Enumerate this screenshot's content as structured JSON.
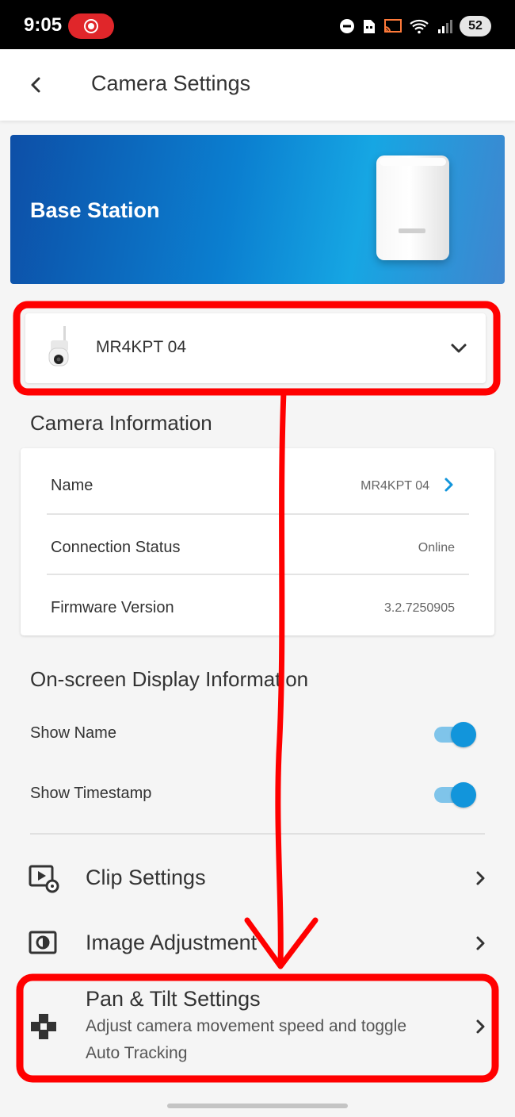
{
  "status_bar": {
    "time": "9:05",
    "battery": "52",
    "icons": [
      "dnd-icon",
      "sim-icon",
      "cast-icon",
      "wifi-icon",
      "signal-icon"
    ]
  },
  "app_bar": {
    "title": "Camera Settings",
    "back_icon": "chevron-left-icon"
  },
  "banner": {
    "title": "Base Station"
  },
  "device_selector": {
    "name": "MR4KPT 04"
  },
  "camera_information": {
    "title": "Camera Information",
    "rows": [
      {
        "label": "Name",
        "value": "MR4KPT 04",
        "has_chevron": true
      },
      {
        "label": "Connection Status",
        "value": "Online",
        "has_chevron": false
      },
      {
        "label": "Firmware Version",
        "value": "3.2.7250905",
        "has_chevron": false
      }
    ]
  },
  "osd": {
    "title": "On-screen Display Information",
    "toggles": [
      {
        "label": "Show Name",
        "on": true
      },
      {
        "label": "Show Timestamp",
        "on": true
      }
    ]
  },
  "menu": [
    {
      "label": "Clip Settings",
      "icon": "clip-settings-icon"
    },
    {
      "label": "Image Adjustment",
      "icon": "image-adjustment-icon"
    },
    {
      "label": "Pan & Tilt Settings",
      "icon": "pan-tilt-icon",
      "sub_line1": "Adjust camera movement speed and toggle",
      "sub_line2": "Auto Tracking"
    }
  ],
  "colors": {
    "accent": "#1295db",
    "toggle_track": "#7fc4ea",
    "annotation": "#ff0000",
    "banner_start": "#0d4fa7",
    "banner_end": "#16a6e3"
  }
}
